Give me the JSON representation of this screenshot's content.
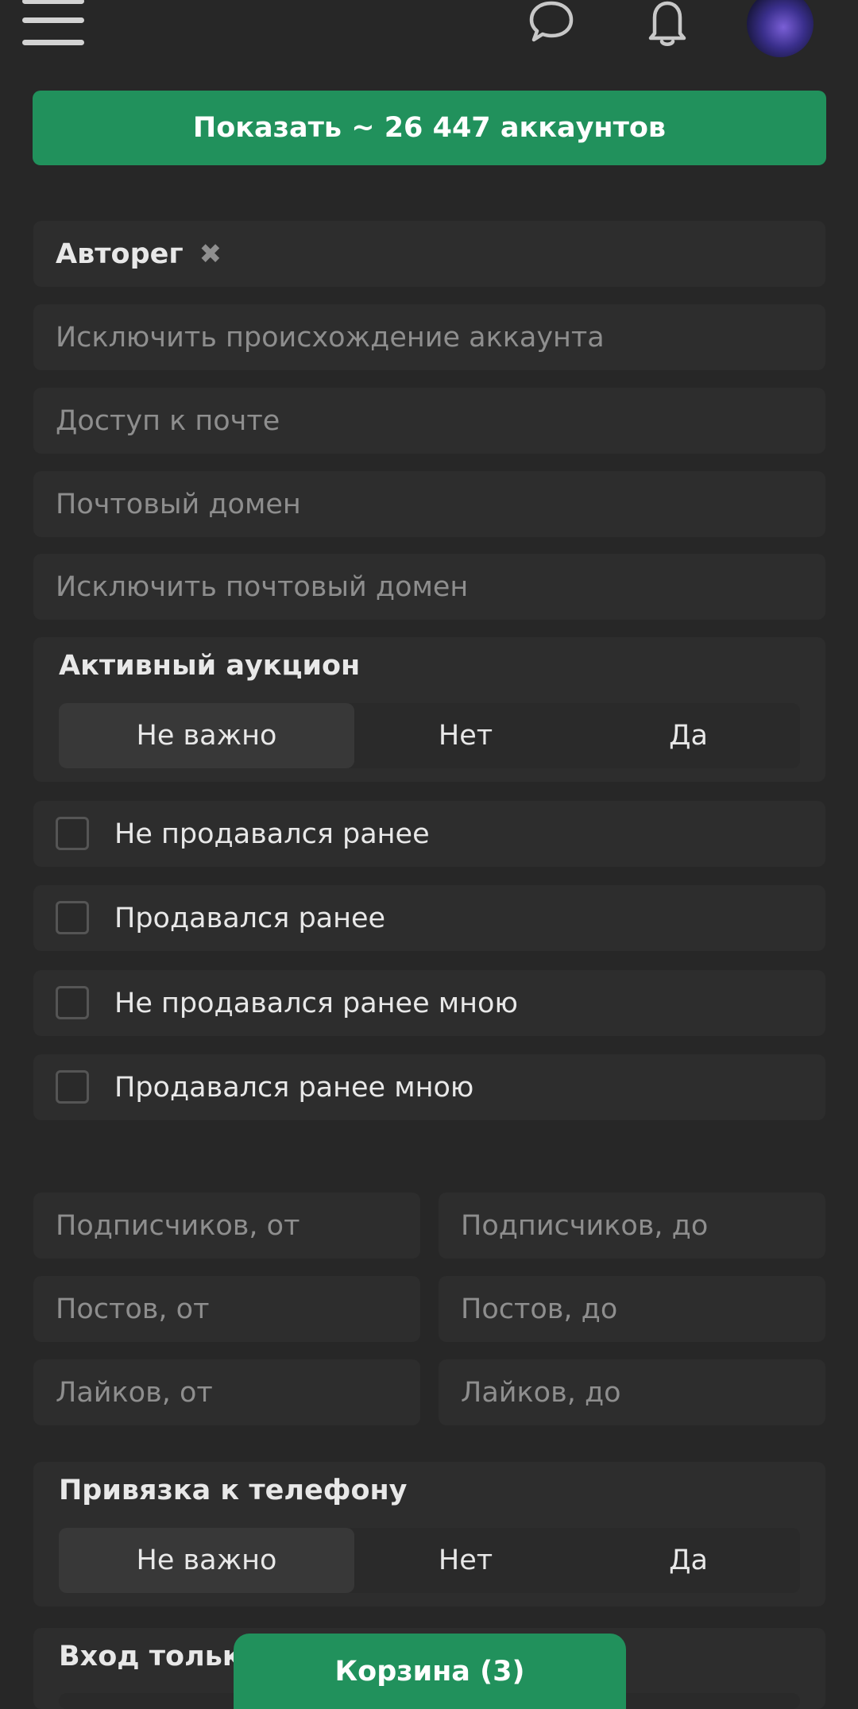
{
  "header": {
    "menu_icon": "hamburger-menu-icon",
    "chat_icon": "chat-bubble-icon",
    "notifications_icon": "bell-icon"
  },
  "show_button": {
    "label": "Показать ~ 26 447 аккаунтов"
  },
  "filters": {
    "origin_tag": "Авторег",
    "exclude_origin_placeholder": "Исключить происхождение аккаунта",
    "mail_access_placeholder": "Доступ к почте",
    "mail_domain_placeholder": "Почтовый домен",
    "exclude_mail_domain_placeholder": "Исключить почтовый домен",
    "auction": {
      "title": "Активный аукцион",
      "options": [
        "Не важно",
        "Нет",
        "Да"
      ],
      "selected": "Не важно"
    },
    "checkboxes": [
      "Не продавался ранее",
      "Продавался ранее",
      "Не продавался ранее мною",
      "Продавался ранее мною"
    ],
    "ranges": {
      "followers_from": "Подписчиков, от",
      "followers_to": "Подписчиков, до",
      "posts_from": "Постов, от",
      "posts_to": "Постов, до",
      "likes_from": "Лайков, от",
      "likes_to": "Лайков, до"
    },
    "phone_binding": {
      "title": "Привязка к телефону",
      "options": [
        "Не важно",
        "Нет",
        "Да"
      ],
      "selected": "Не важно"
    },
    "login_only_title": "Вход только"
  },
  "cart_button": {
    "label": "Корзина (3)"
  },
  "colors": {
    "background": "#272727",
    "field": "#2d2d2d",
    "accent_green": "#21915c",
    "placeholder_text": "#8e8e8e"
  }
}
